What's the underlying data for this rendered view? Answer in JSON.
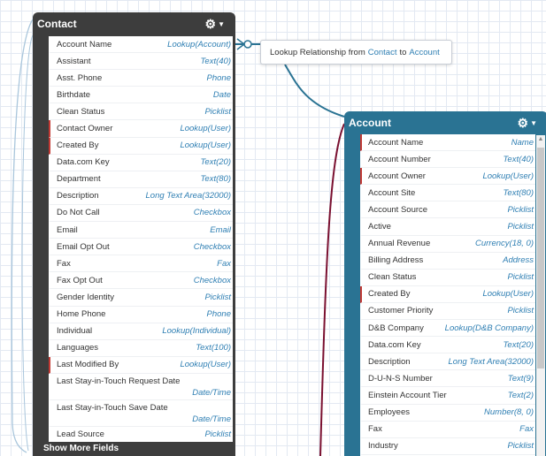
{
  "tooltip": {
    "prefix": "Lookup Relationship from",
    "from": "Contact",
    "middle": "to",
    "to": "Account"
  },
  "contact": {
    "title": "Contact",
    "show_more": "Show More Fields",
    "fields": [
      {
        "name": "Account Name",
        "type": "Lookup(Account)",
        "required": false
      },
      {
        "name": "Assistant",
        "type": "Text(40)",
        "required": false
      },
      {
        "name": "Asst. Phone",
        "type": "Phone",
        "required": false
      },
      {
        "name": "Birthdate",
        "type": "Date",
        "required": false
      },
      {
        "name": "Clean Status",
        "type": "Picklist",
        "required": false
      },
      {
        "name": "Contact Owner",
        "type": "Lookup(User)",
        "required": true
      },
      {
        "name": "Created By",
        "type": "Lookup(User)",
        "required": true
      },
      {
        "name": "Data.com Key",
        "type": "Text(20)",
        "required": false
      },
      {
        "name": "Department",
        "type": "Text(80)",
        "required": false
      },
      {
        "name": "Description",
        "type": "Long Text Area(32000)",
        "required": false
      },
      {
        "name": "Do Not Call",
        "type": "Checkbox",
        "required": false
      },
      {
        "name": "Email",
        "type": "Email",
        "required": false
      },
      {
        "name": "Email Opt Out",
        "type": "Checkbox",
        "required": false
      },
      {
        "name": "Fax",
        "type": "Fax",
        "required": false
      },
      {
        "name": "Fax Opt Out",
        "type": "Checkbox",
        "required": false
      },
      {
        "name": "Gender Identity",
        "type": "Picklist",
        "required": false
      },
      {
        "name": "Home Phone",
        "type": "Phone",
        "required": false
      },
      {
        "name": "Individual",
        "type": "Lookup(Individual)",
        "required": false
      },
      {
        "name": "Languages",
        "type": "Text(100)",
        "required": false
      },
      {
        "name": "Last Modified By",
        "type": "Lookup(User)",
        "required": true
      },
      {
        "name": "Last Stay-in-Touch Request Date",
        "type": "Date/Time",
        "required": false,
        "tall": true
      },
      {
        "name": "Last Stay-in-Touch Save Date",
        "type": "Date/Time",
        "required": false,
        "tall": true
      },
      {
        "name": "Lead Source",
        "type": "Picklist",
        "required": false
      }
    ]
  },
  "account": {
    "title": "Account",
    "fields": [
      {
        "name": "Account Name",
        "type": "Name",
        "required": true
      },
      {
        "name": "Account Number",
        "type": "Text(40)",
        "required": false
      },
      {
        "name": "Account Owner",
        "type": "Lookup(User)",
        "required": true
      },
      {
        "name": "Account Site",
        "type": "Text(80)",
        "required": false
      },
      {
        "name": "Account Source",
        "type": "Picklist",
        "required": false
      },
      {
        "name": "Active",
        "type": "Picklist",
        "required": false
      },
      {
        "name": "Annual Revenue",
        "type": "Currency(18, 0)",
        "required": false
      },
      {
        "name": "Billing Address",
        "type": "Address",
        "required": false
      },
      {
        "name": "Clean Status",
        "type": "Picklist",
        "required": false
      },
      {
        "name": "Created By",
        "type": "Lookup(User)",
        "required": true
      },
      {
        "name": "Customer Priority",
        "type": "Picklist",
        "required": false
      },
      {
        "name": "D&B Company",
        "type": "Lookup(D&B Company)",
        "required": false
      },
      {
        "name": "Data.com Key",
        "type": "Text(20)",
        "required": false
      },
      {
        "name": "Description",
        "type": "Long Text Area(32000)",
        "required": false
      },
      {
        "name": "D-U-N-S Number",
        "type": "Text(9)",
        "required": false
      },
      {
        "name": "Einstein Account Tier",
        "type": "Text(2)",
        "required": false
      },
      {
        "name": "Employees",
        "type": "Number(8, 0)",
        "required": false
      },
      {
        "name": "Fax",
        "type": "Fax",
        "required": false
      },
      {
        "name": "Industry",
        "type": "Picklist",
        "required": false
      }
    ]
  },
  "icons": {
    "settings": "gear-icon",
    "menu": "chevron-down-icon"
  }
}
